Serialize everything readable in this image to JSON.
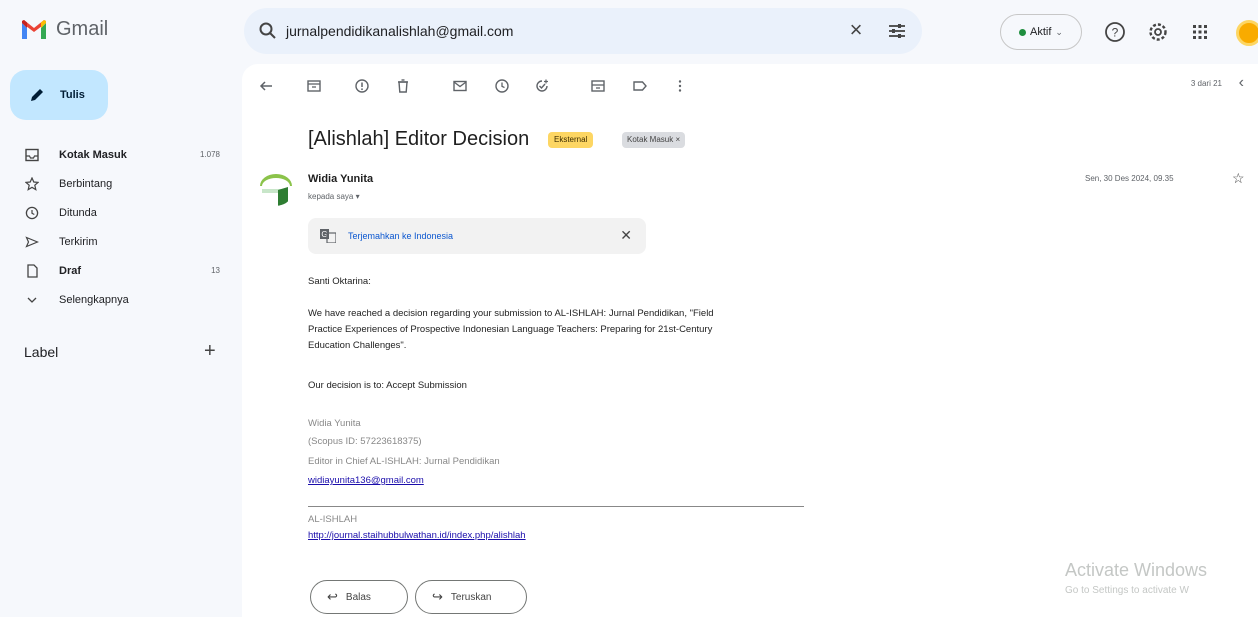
{
  "header": {
    "app_name": "Gmail",
    "search_value": "jurnalpendidikanalishlah@gmail.com",
    "status_label": "Aktif"
  },
  "sidebar": {
    "compose_label": "Tulis",
    "items": [
      {
        "label": "Kotak Masuk",
        "count": "1.078"
      },
      {
        "label": "Berbintang",
        "count": ""
      },
      {
        "label": "Ditunda",
        "count": ""
      },
      {
        "label": "Terkirim",
        "count": ""
      },
      {
        "label": "Draf",
        "count": "13"
      },
      {
        "label": "Selengkapnya",
        "count": ""
      }
    ],
    "label_heading": "Label"
  },
  "toolbar": {
    "pager": "3 dari 21"
  },
  "email": {
    "subject": "[Alishlah] Editor Decision",
    "badge_external": "Eksternal",
    "badge_inbox": "Kotak Masuk ×",
    "sender_name": "Widia Yunita",
    "to_line": "kepada saya ▾",
    "date": "Sen, 30 Des 2024, 09.35",
    "translate_label": "Terjemahkan ke Indonesia",
    "greeting": "Santi Oktarina:",
    "paragraph_1": "We have reached a decision regarding your submission to AL-ISHLAH: Jurnal Pendidikan, \"Field Practice Experiences of Prospective Indonesian Language Teachers: Preparing for 21st-Century Education Challenges\".",
    "decision": "Our decision is to: Accept Submission",
    "sig_name": "Widia Yunita",
    "sig_scopus": "(Scopus ID: 57223618375)",
    "sig_role": "Editor in Chief AL-ISHLAH: Jurnal Pendidikan",
    "sig_email": "widiayunita136@gmail.com",
    "footer_org": "AL-ISHLAH",
    "footer_url": "http://journal.staihubbulwathan.id/index.php/alishlah"
  },
  "actions": {
    "reply_label": "Balas",
    "forward_label": "Teruskan"
  },
  "watermark": {
    "line1": "Activate Windows",
    "line2": "Go to Settings to activate W"
  }
}
